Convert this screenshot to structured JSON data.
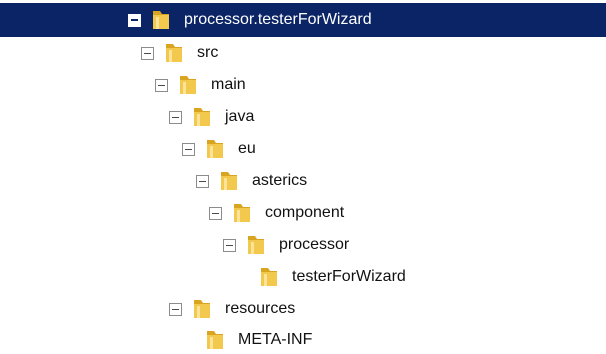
{
  "tree": {
    "nodes": [
      {
        "label": "processor.testerForWizard",
        "depth": 0,
        "expanded": true,
        "selected": true
      },
      {
        "label": "src",
        "depth": 1,
        "expanded": true,
        "selected": false
      },
      {
        "label": "main",
        "depth": 2,
        "expanded": true,
        "selected": false
      },
      {
        "label": "java",
        "depth": 3,
        "expanded": true,
        "selected": false
      },
      {
        "label": "eu",
        "depth": 4,
        "expanded": true,
        "selected": false
      },
      {
        "label": "asterics",
        "depth": 5,
        "expanded": true,
        "selected": false
      },
      {
        "label": "component",
        "depth": 6,
        "expanded": true,
        "selected": false
      },
      {
        "label": "processor",
        "depth": 7,
        "expanded": true,
        "selected": false
      },
      {
        "label": "testerForWizard",
        "depth": 8,
        "expanded": false,
        "selected": false
      },
      {
        "label": "resources",
        "depth": 3,
        "expanded": true,
        "selected": false
      },
      {
        "label": "META-INF",
        "depth": 4,
        "expanded": false,
        "selected": false
      }
    ]
  },
  "colors": {
    "selection_bg": "#0a2466",
    "folder": "#f2c94c"
  }
}
